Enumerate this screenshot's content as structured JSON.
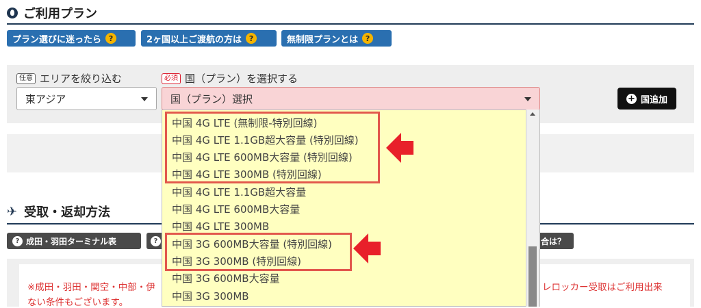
{
  "section1": {
    "title": "ご利用プラン"
  },
  "help_buttons": [
    {
      "label": "プラン選びに迷ったら"
    },
    {
      "label": "2ヶ国以上ご渡航の方は"
    },
    {
      "label": "無制限プランとは"
    }
  ],
  "filter": {
    "area_tag": "任意",
    "area_label": "エリアを絞り込む",
    "area_value": "東アジア",
    "country_tag": "必須",
    "country_label": "国（プラン）を選択する",
    "country_value": "国（プラン）選択",
    "add_button": "国追加"
  },
  "dropdown_options": [
    "中国 4G LTE (無制限-特別回線)",
    "中国 4G LTE 1.1GB超大容量 (特別回線)",
    "中国 4G LTE 600MB大容量 (特別回線)",
    "中国 4G LTE 300MB (特別回線)",
    "中国 4G LTE 1.1GB超大容量",
    "中国 4G LTE 600MB大容量",
    "中国 4G LTE 300MB",
    "中国 3G 600MB大容量 (特別回線)",
    "中国 3G 300MB (特別回線)",
    "中国 3G 600MB大容量",
    "中国 3G 300MB"
  ],
  "section2": {
    "title": "受取・返却方法"
  },
  "terminal_buttons": [
    {
      "label": "成田・羽田ターミナル表"
    },
    {
      "label": "合は？"
    }
  ],
  "notes": {
    "left_line1": "※成田・羽田・関空・中部・伊",
    "left_line2": "ない条件もございます。",
    "right_line1": "レロッカー受取はご利用出来"
  },
  "colors": {
    "accent_blue": "#2a6fb0",
    "highlight_red": "#e2584c",
    "arrow_red": "#e8202a",
    "dropdown_bg": "#ffffc0",
    "select_pink": "#f9d4d6"
  }
}
